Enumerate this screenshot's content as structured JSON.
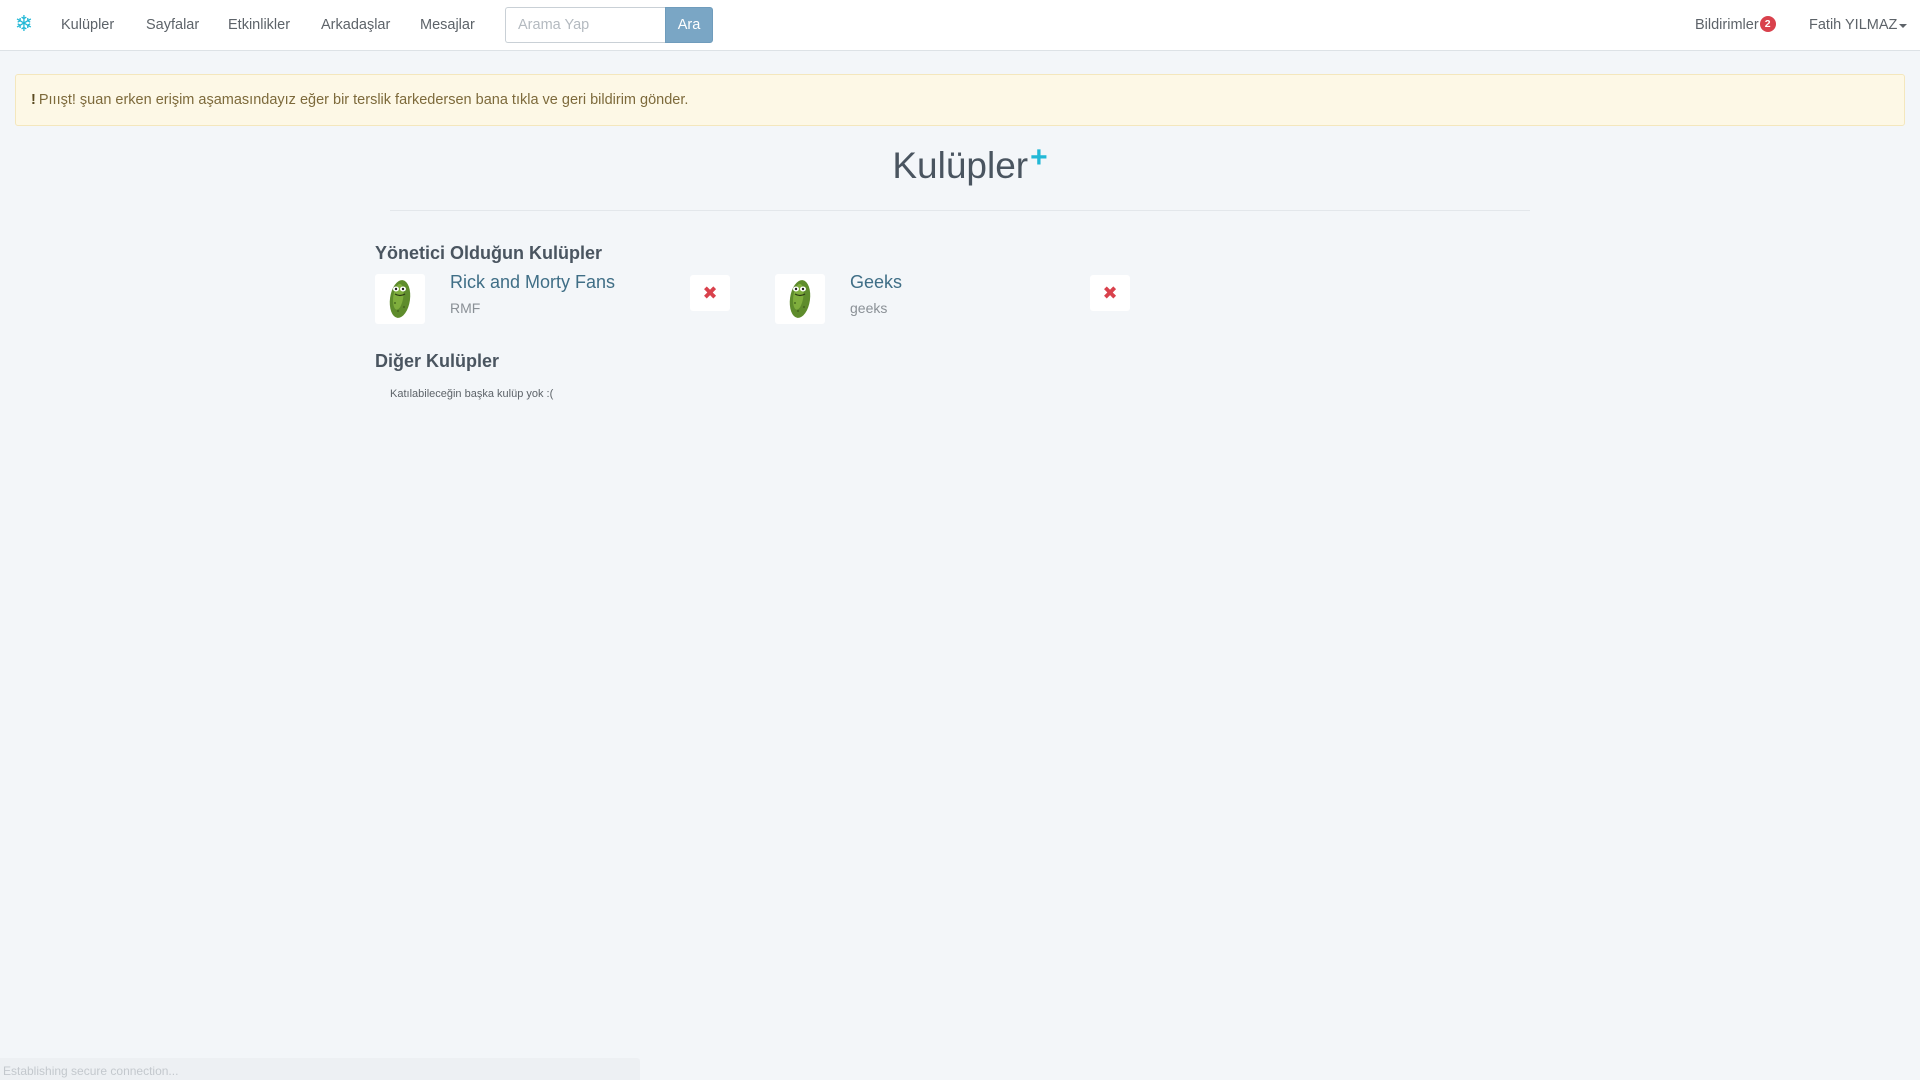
{
  "navbar": {
    "brand_icon": "snowflake-icon",
    "links": [
      "Kulüpler",
      "Sayfalar",
      "Etkinlikler",
      "Arkadaşlar",
      "Mesajlar"
    ],
    "search": {
      "placeholder": "Arama Yap",
      "value": "",
      "button_label": "Ara"
    },
    "notifications": {
      "label": "Bildirimler",
      "count": "2"
    },
    "user": {
      "name": "Fatih YILMAZ"
    }
  },
  "alert": {
    "bang": "!",
    "text": "Pııışt! şuan erken erişim aşamasındayız eğer bir terslik farkedersen bana tıkla ve geri bildirim gönder."
  },
  "page": {
    "title": "Kulüpler",
    "add_icon": "plus-icon"
  },
  "admin_section": {
    "title": "Yönetici Olduğun Kulüpler",
    "clubs": [
      {
        "name": "Rick and Morty Fans",
        "handle": "RMF",
        "avatar_icon": "pickle-icon",
        "remove_icon": "close-icon"
      },
      {
        "name": "Geeks",
        "handle": "geeks",
        "avatar_icon": "pickle-icon",
        "remove_icon": "close-icon"
      }
    ]
  },
  "other_section": {
    "title": "Diğer Kulüpler",
    "empty_message": "Katılabileceğin başka kulüp yok :("
  },
  "status_bar": {
    "text": "Establishing secure connection..."
  },
  "colors": {
    "accent": "#22b8d6",
    "danger": "#d9414c",
    "button": "#7aa6c5",
    "alert_bg": "#fdf8e6",
    "page_bg": "#f3f6f9"
  }
}
